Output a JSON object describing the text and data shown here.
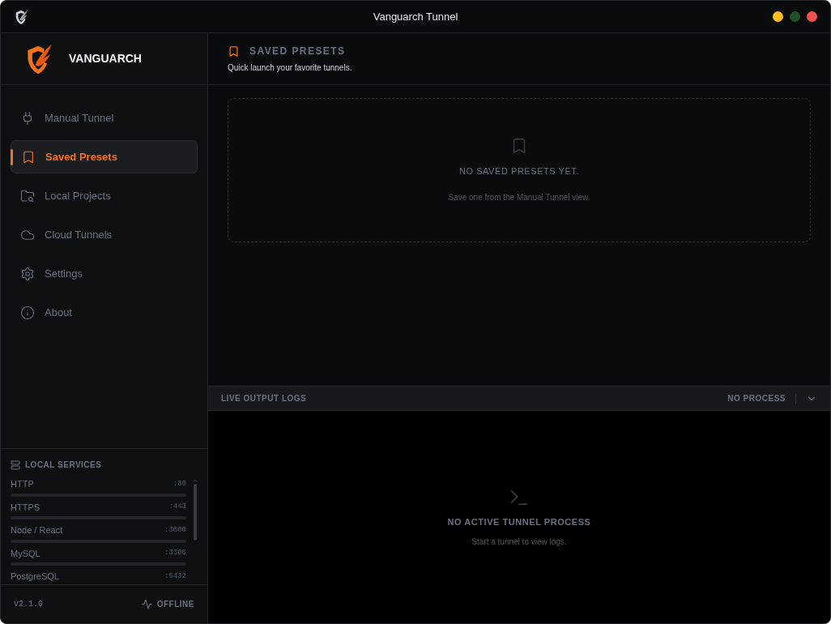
{
  "window": {
    "title": "Vanguarch Tunnel"
  },
  "brand": {
    "name": "VANGUARCH"
  },
  "nav": [
    {
      "label": "Manual Tunnel",
      "selected": false
    },
    {
      "label": "Saved Presets",
      "selected": true
    },
    {
      "label": "Local Projects",
      "selected": false
    },
    {
      "label": "Cloud Tunnels",
      "selected": false
    },
    {
      "label": "Settings",
      "selected": false
    },
    {
      "label": "About",
      "selected": false
    }
  ],
  "services": {
    "title": "LOCAL SERVICES",
    "items": [
      {
        "name": "HTTP",
        "port": ":80"
      },
      {
        "name": "HTTPS",
        "port": ":443"
      },
      {
        "name": "Node / React",
        "port": ":3000"
      },
      {
        "name": "MySQL",
        "port": ":3306"
      },
      {
        "name": "PostgreSQL",
        "port": ":5432"
      }
    ]
  },
  "footer": {
    "version": "v2.1.0",
    "status": "OFFLINE"
  },
  "page": {
    "title": "SAVED PRESETS",
    "subtitle": "Quick launch your favorite tunnels.",
    "empty_title": "NO SAVED PRESETS YET.",
    "empty_hint": "Save one from the Manual Tunnel view."
  },
  "logs": {
    "title": "LIVE OUTPUT LOGS",
    "status": "NO PROCESS",
    "expanded": true,
    "empty_title": "NO ACTIVE TUNNEL PROCESS",
    "empty_hint": "Start a tunnel to view logs."
  }
}
